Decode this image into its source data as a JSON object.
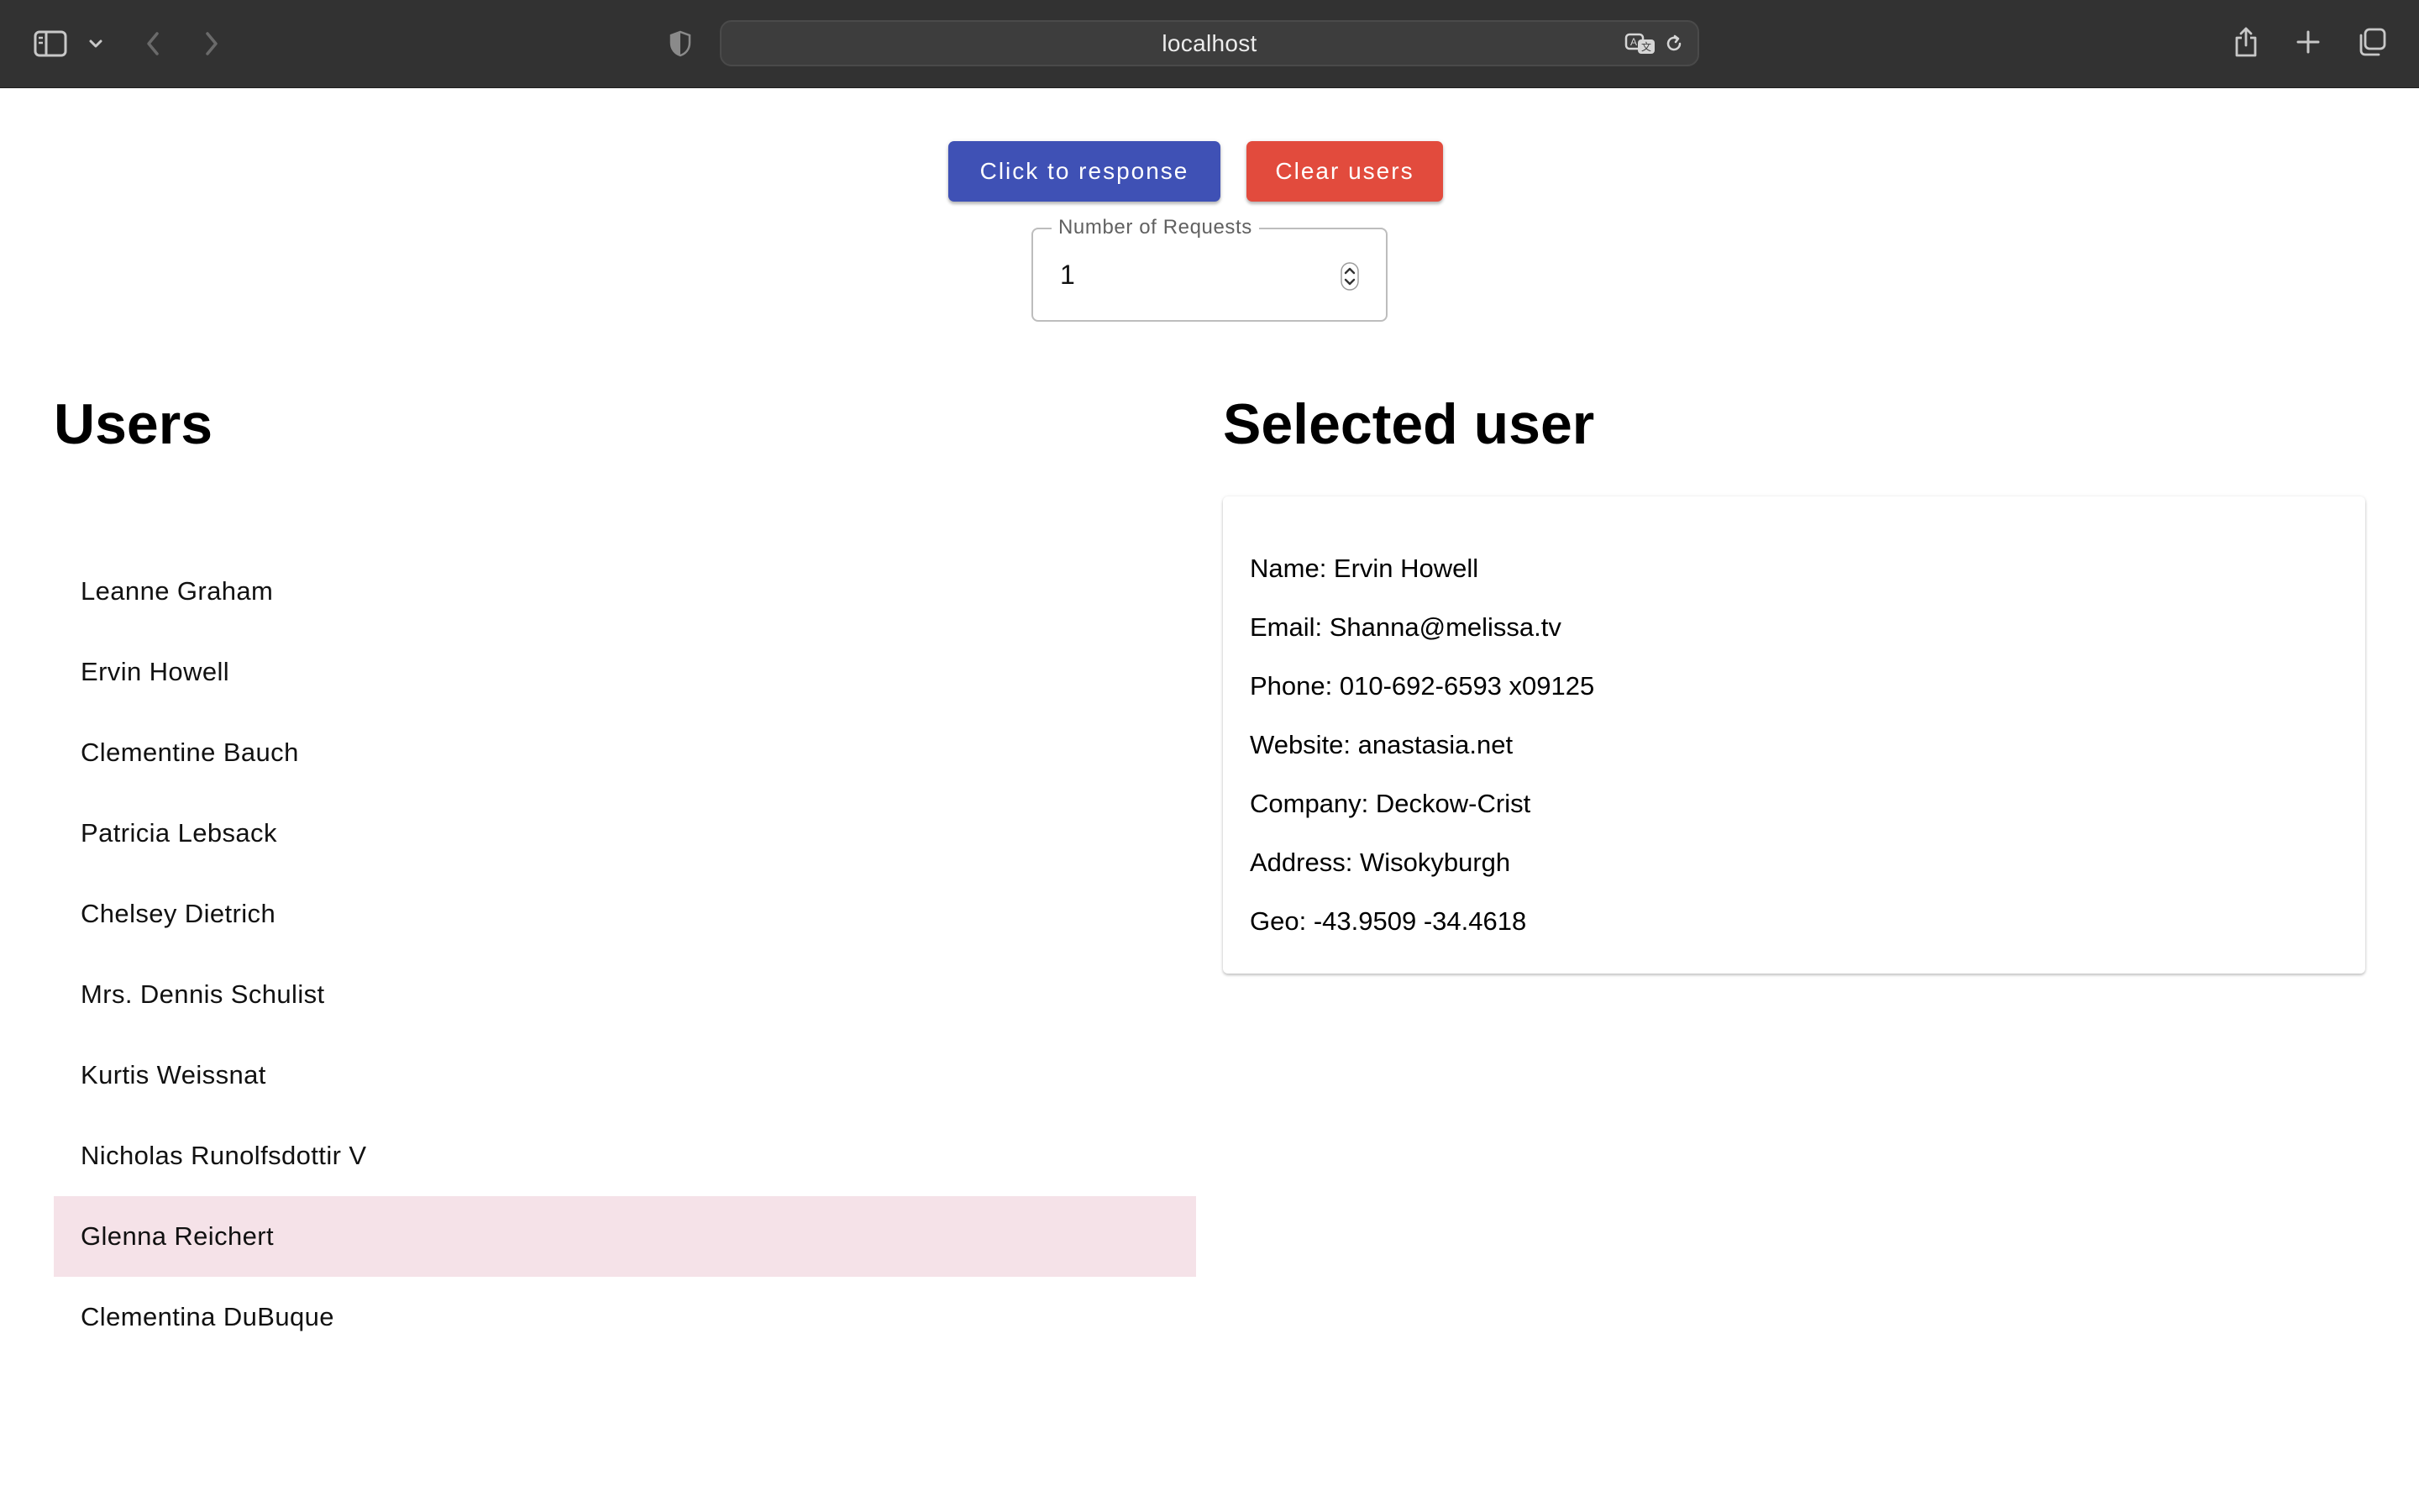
{
  "browser": {
    "url": "localhost"
  },
  "controls": {
    "response_button_label": "Click to response",
    "clear_button_label": "Clear users",
    "requests_field": {
      "label": "Number of Requests",
      "value": "1"
    }
  },
  "users_panel": {
    "title": "Users",
    "items": [
      {
        "name": "Leanne Graham"
      },
      {
        "name": "Ervin Howell"
      },
      {
        "name": "Clementine Bauch"
      },
      {
        "name": "Patricia Lebsack"
      },
      {
        "name": "Chelsey Dietrich"
      },
      {
        "name": "Mrs. Dennis Schulist"
      },
      {
        "name": "Kurtis Weissnat"
      },
      {
        "name": "Nicholas Runolfsdottir V"
      },
      {
        "name": "Glenna Reichert"
      },
      {
        "name": "Clementina DuBuque"
      }
    ],
    "hovered_index": 8
  },
  "selected_panel": {
    "title": "Selected user",
    "lines": {
      "name": "Name: Ervin Howell",
      "email": "Email: Shanna@melissa.tv",
      "phone": "Phone: 010-692-6593 x09125",
      "website": "Website: anastasia.net",
      "company": "Company: Deckow-Crist",
      "address": "Address: Wisokyburgh",
      "geo": "Geo: -43.9509 -34.4618"
    }
  },
  "colors": {
    "primary": "#3f51b5",
    "danger": "#e24b3d",
    "hover_row": "#f5e2e8",
    "chrome": "#323232"
  }
}
